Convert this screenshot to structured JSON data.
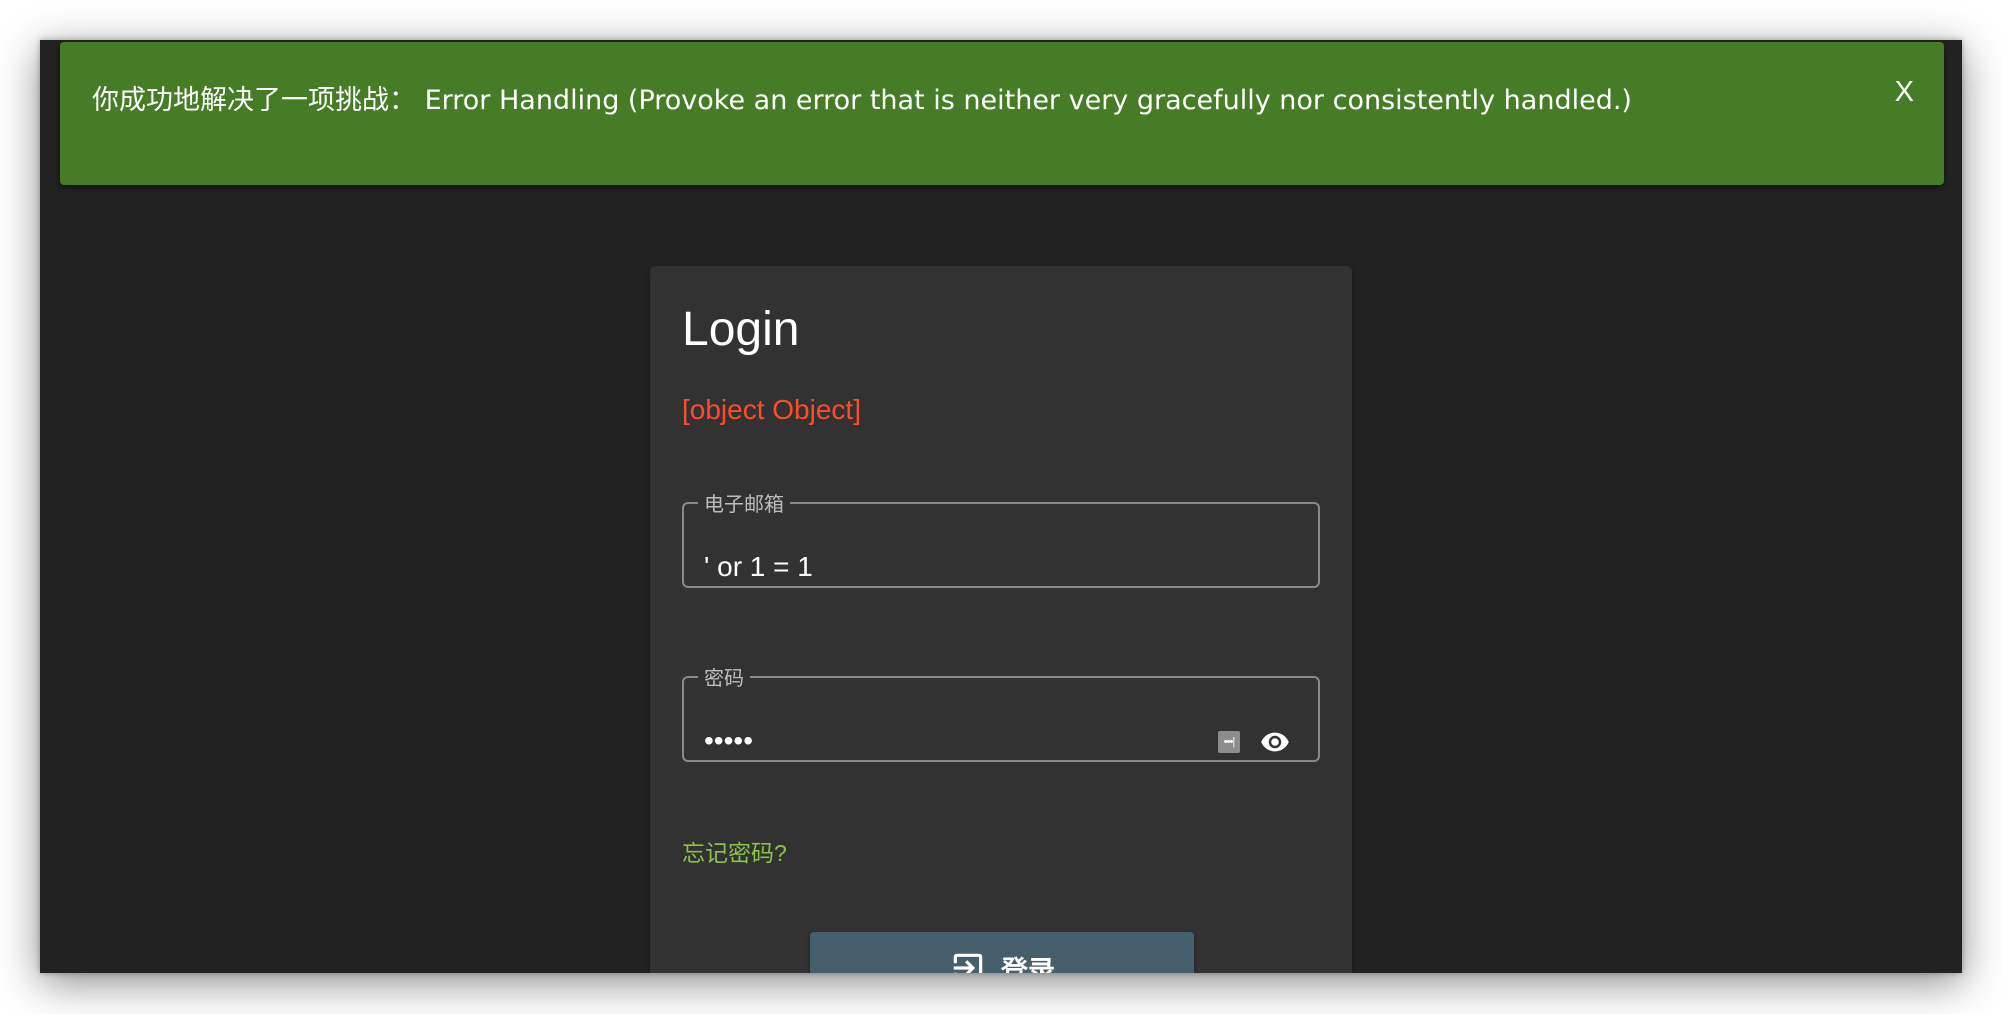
{
  "banner": {
    "message": "你成功地解决了一项挑战： Error Handling (Provoke an error that is neither very gracefully nor consistently handled.)",
    "close_label": "X",
    "color": "#467c25"
  },
  "login": {
    "title": "Login",
    "error_message": "[object Object]",
    "email": {
      "label": "电子邮箱",
      "value": "' or 1 = 1"
    },
    "password": {
      "label": "密码",
      "value": "•••••"
    },
    "forgot_password": "忘记密码?",
    "submit_label": "登录"
  },
  "colors": {
    "background": "#222222",
    "card": "#323232",
    "error": "#ff4b2b",
    "link": "#8bc34a",
    "button": "#455f6c"
  },
  "icons": {
    "banner_close": "close-icon",
    "password_manager": "keychain-icon",
    "toggle_visibility": "eye-icon",
    "login": "login-icon"
  }
}
